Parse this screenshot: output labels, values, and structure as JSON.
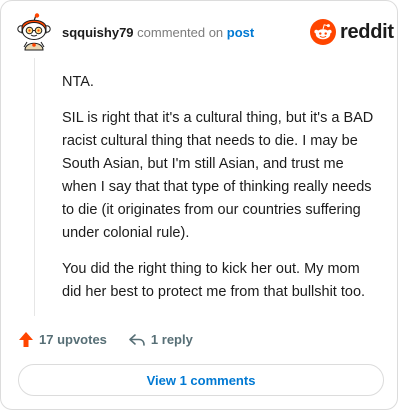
{
  "comment": {
    "username": "sqquishy79",
    "commented_on_text": "commented on",
    "post_link": "post",
    "paragraphs": [
      "NTA.",
      "SIL is right that it's a cultural thing, but it's a BAD racist cultural thing that needs to die. I may be South Asian, but I'm still Asian, and trust me when I say that that type of thinking really needs to die (it originates from our countries suffering under colonial rule).",
      "You did the right thing to kick her out. My mom did her best to protect me from that bullshit too."
    ]
  },
  "brand": {
    "wordmark": "reddit",
    "icon": "reddit-snoo-icon",
    "accent": "#ff4500"
  },
  "actions": {
    "upvotes_label": "17 upvotes",
    "reply_label": "1 reply",
    "upvote_icon": "upvote-arrow-icon",
    "reply_icon": "reply-arrow-icon",
    "upvote_color": "#ff4500"
  },
  "footer": {
    "view_comments_label": "View 1 comments",
    "link_color": "#0079d3"
  }
}
